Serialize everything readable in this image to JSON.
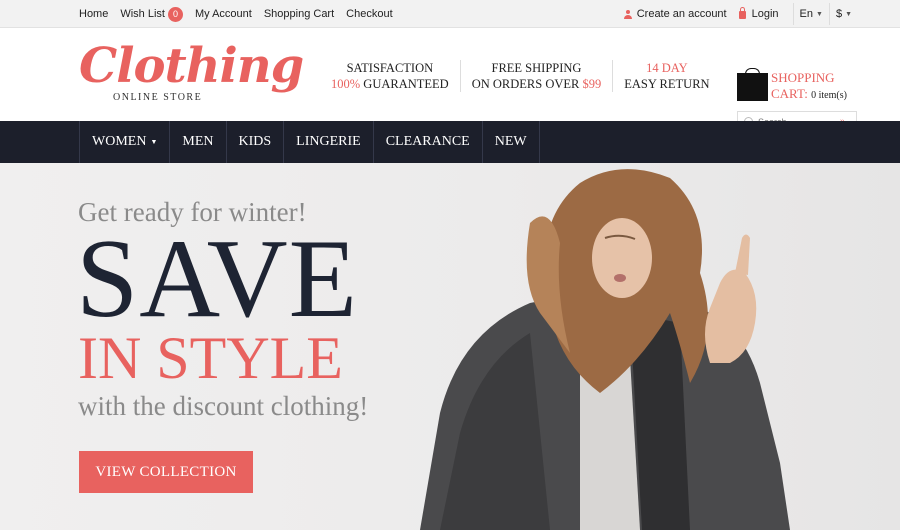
{
  "topbar": {
    "links": [
      {
        "label": "Home"
      },
      {
        "label": "Wish List",
        "badge": "0"
      },
      {
        "label": "My Account"
      },
      {
        "label": "Shopping Cart"
      },
      {
        "label": "Checkout"
      }
    ],
    "create_account": "Create an account",
    "login": "Login",
    "language": "En",
    "currency": "$"
  },
  "header": {
    "logo_text": "Clothing",
    "logo_sub": "ONLINE STORE",
    "features": [
      {
        "line1": "SATISFACTION",
        "line2_accent": "100%",
        "line2_rest": " GUARANTEED"
      },
      {
        "line1": "FREE SHIPPING",
        "line2_rest": "ON ORDERS OVER ",
        "line2_accent_end": "$99"
      },
      {
        "line1_accent": "14 DAY",
        "line2_rest": "EASY RETURN"
      }
    ],
    "cart_label_1": "SHOPPING",
    "cart_label_2": "CART:",
    "cart_count": "0 item(s)",
    "search_placeholder": "Search..."
  },
  "nav": {
    "items": [
      "WOMEN",
      "MEN",
      "KIDS",
      "LINGERIE",
      "CLEARANCE",
      "NEW"
    ]
  },
  "hero": {
    "tagline": "Get ready for winter!",
    "headline": "SAVE",
    "subheadline": "IN STYLE",
    "description": "with the discount clothing!",
    "button": "VIEW COLLECTION"
  },
  "colors": {
    "accent": "#e8625f",
    "nav_bg": "#1c1f2b",
    "headline": "#1e2433"
  }
}
